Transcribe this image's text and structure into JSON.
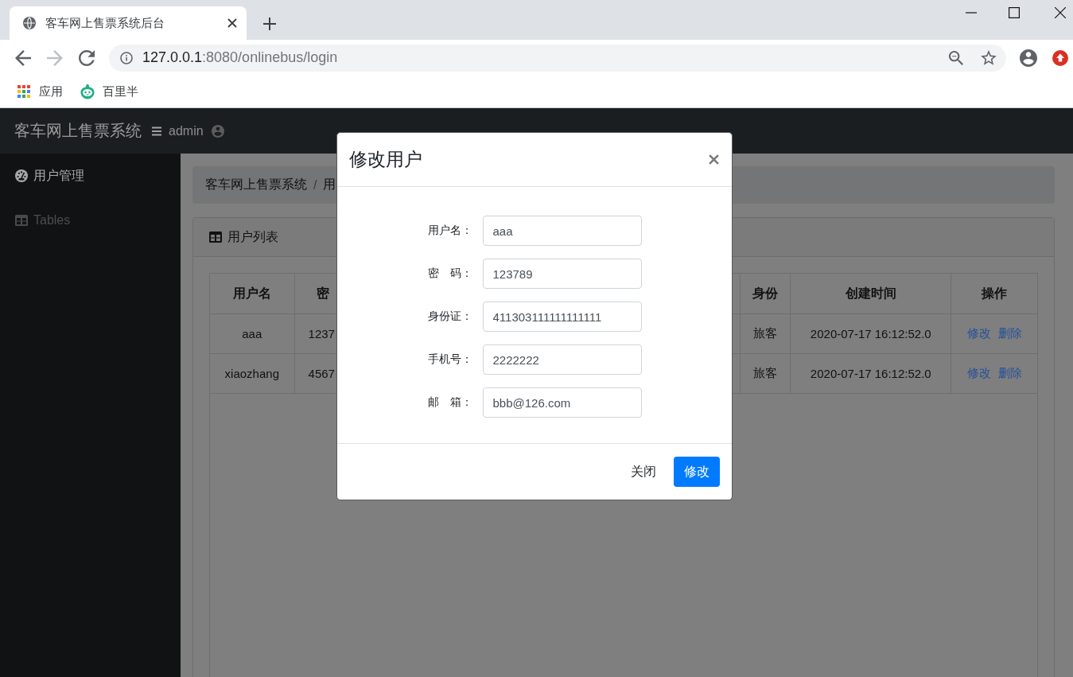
{
  "browser": {
    "tabs": [
      {
        "title": "客车网上售票系统后台",
        "selected": true
      }
    ],
    "nav_buttons": [
      {
        "kind": "back",
        "disabled": false
      },
      {
        "kind": "forward",
        "disabled": true
      },
      {
        "kind": "reload",
        "disabled": false
      }
    ],
    "address": {
      "host": "127.0.0.1",
      "path": ":8080/onlinebus/login"
    },
    "bookmarks": [
      {
        "kind": "apps",
        "label": "应用"
      },
      {
        "kind": "site",
        "label": "百里半"
      }
    ]
  },
  "navbar": {
    "brand": "客车网上售票系统",
    "user": "admin"
  },
  "sidebar": {
    "items": [
      {
        "kind": "dashboard",
        "label": "用户管理",
        "selected": true
      },
      {
        "kind": "table",
        "label": "Tables",
        "selected": false
      }
    ]
  },
  "breadcrumb": {
    "items": [
      "客车网上售票系统",
      "用"
    ],
    "separator": "/"
  },
  "card": {
    "title": "用户列表"
  },
  "table": {
    "columns": [
      "用户名",
      "密",
      "身份",
      "创建时间",
      "操作"
    ],
    "rows": [
      {
        "cells": [
          "aaa",
          "1237",
          "旅客",
          "2020-07-17 16:12:52.0"
        ],
        "actions": [
          "修改",
          "删除"
        ]
      },
      {
        "cells": [
          "xiaozhang",
          "4567",
          "旅客",
          "2020-07-17 16:12:52.0"
        ],
        "actions": [
          "修改",
          "删除"
        ]
      }
    ]
  },
  "modal": {
    "title": "修改用户",
    "fields": [
      {
        "label": "用户名：",
        "value": "aaa"
      },
      {
        "label": "密　码：",
        "value": "123789"
      },
      {
        "label": "身份证：",
        "value": "411303111111111111"
      },
      {
        "label": "手机号：",
        "value": "2222222"
      },
      {
        "label": "邮　箱：",
        "value": "bbb@126.com"
      }
    ],
    "buttons": [
      {
        "kind": "secondary",
        "label": "关闭"
      },
      {
        "kind": "primary",
        "label": "修改"
      }
    ]
  }
}
